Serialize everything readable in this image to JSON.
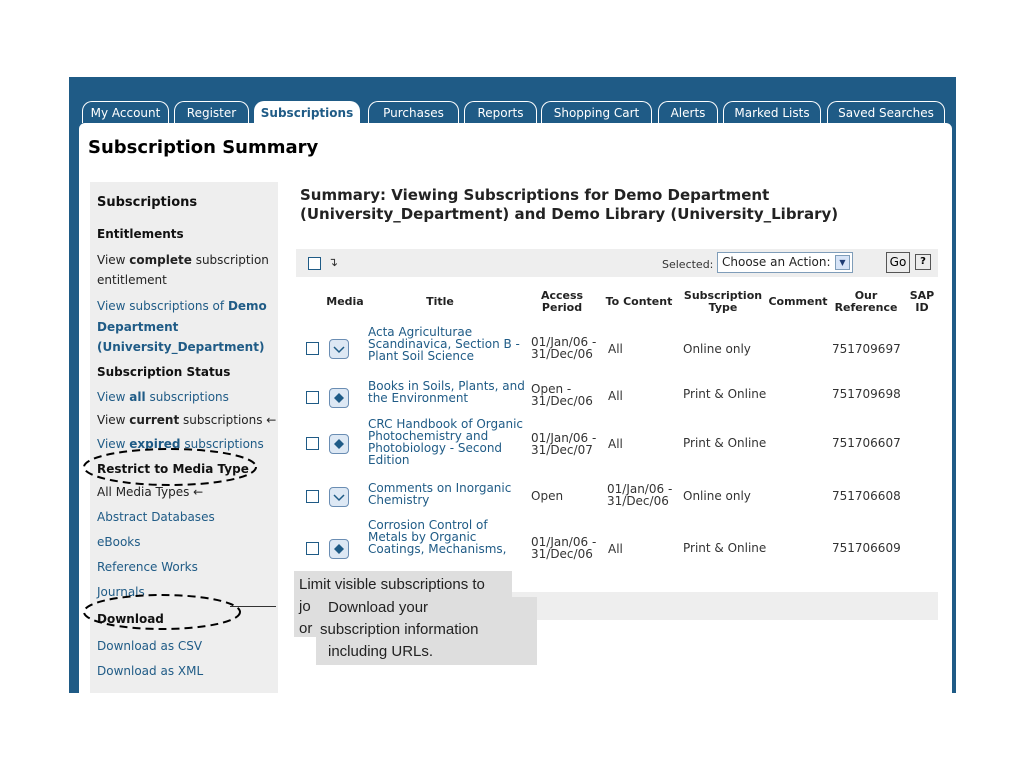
{
  "tabs": [
    {
      "label": "My Account"
    },
    {
      "label": "Register"
    },
    {
      "label": "Subscriptions"
    },
    {
      "label": "Purchases"
    },
    {
      "label": "Reports"
    },
    {
      "label": "Shopping Cart"
    },
    {
      "label": "Alerts"
    },
    {
      "label": "Marked Lists"
    },
    {
      "label": "Saved Searches"
    }
  ],
  "page_title": "Subscription Summary",
  "sidebar": {
    "heading": "Subscriptions",
    "entitlements_heading": "Entitlements",
    "view_complete": {
      "pre": "View ",
      "bold": "complete",
      "post": " subscription"
    },
    "view_complete_line2": "entitlement",
    "view_subs_of": {
      "pre": "View subscriptions of ",
      "bold": "Demo"
    },
    "view_subs_of_line2": "Department",
    "view_subs_of_line3": "(University_Department)",
    "status_heading": "Subscription Status",
    "view_all": {
      "pre": "View ",
      "bold": "all",
      "post": " subscriptions"
    },
    "view_current": {
      "pre": "View ",
      "bold": "current",
      "post": " subscriptions ←"
    },
    "view_expired": {
      "pre": "View ",
      "bold": "expired",
      "post": " subscriptions"
    },
    "media_heading": "Restrict to Media Type",
    "media_all": "All Media Types ←",
    "media_abstract": "Abstract Databases",
    "media_ebooks": "eBooks",
    "media_reference": "Reference Works",
    "media_journals": "Journals",
    "download_heading": "Download",
    "download_csv": "Download as CSV",
    "download_xml": "Download as XML"
  },
  "summary_title_line1": "Summary: Viewing Subscriptions for Demo Department",
  "summary_title_line2": "(University_Department) and Demo Library (University_Library)",
  "action_bar": {
    "arrow_glyph": "↴",
    "selected_label": "Selected:",
    "action_select_value": "Choose an Action:",
    "go_label": "Go",
    "help_label": "?"
  },
  "table": {
    "headers": {
      "media": "Media",
      "title": "Title",
      "access_period": [
        "Access",
        "Period"
      ],
      "to_content": "To Content",
      "subscription_type": [
        "Subscription",
        "Type"
      ],
      "comment": "Comment",
      "our_reference": [
        "Our",
        "Reference"
      ],
      "sap_id": [
        "SAP",
        "ID"
      ]
    },
    "rows": [
      {
        "media": "journal-icon",
        "title": [
          "Acta Agriculturae",
          "Scandinavica, Section B -",
          "Plant Soil Science"
        ],
        "access": [
          "01/Jan/06 -",
          "31/Dec/06"
        ],
        "to_content": [
          "All"
        ],
        "type": "Online only",
        "reference": "751709697"
      },
      {
        "media": "book-icon",
        "title": [
          "Books in Soils, Plants, and",
          "the Environment"
        ],
        "access": [
          "Open -",
          "31/Dec/06"
        ],
        "to_content": [
          "All"
        ],
        "type": "Print & Online",
        "reference": "751709698"
      },
      {
        "media": "book-icon",
        "title": [
          "CRC Handbook of Organic",
          "Photochemistry and",
          "Photobiology - Second",
          "Edition"
        ],
        "access": [
          "01/Jan/06 -",
          "31/Dec/07"
        ],
        "to_content": [
          "All"
        ],
        "type": "Print & Online",
        "reference": "751706607"
      },
      {
        "media": "journal-icon",
        "title": [
          "Comments on Inorganic",
          "Chemistry"
        ],
        "access": [
          "Open"
        ],
        "to_content": [
          "01/Jan/06 -",
          "31/Dec/06"
        ],
        "type": "Online only",
        "reference": "751706608"
      },
      {
        "media": "book-icon",
        "title": [
          "Corrosion Control of",
          "Metals by Organic",
          "Coatings, Mechanisms,"
        ],
        "access": [
          "01/Jan/06 -",
          "31/Dec/06"
        ],
        "to_content": [
          "All"
        ],
        "type": "Print & Online",
        "reference": "751706609"
      }
    ]
  },
  "callouts": {
    "media_line1": "Limit visible subscriptions to",
    "media_line2_frag": "jo",
    "media_line3_frag": "or",
    "download_line1": "Download your",
    "download_line2": "subscription information",
    "download_line3": "including URLs."
  },
  "colors": {
    "brand": "#1f5b86",
    "sidebar_bg": "#eeeeee",
    "callout_bg": "#dedede"
  }
}
